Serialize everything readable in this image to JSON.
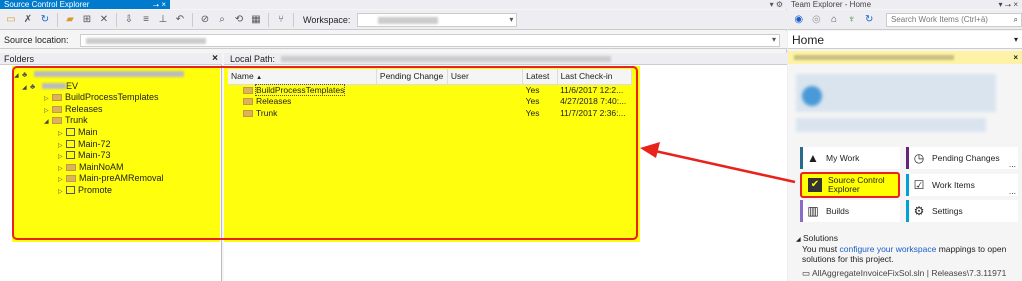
{
  "sce": {
    "tab_title": "Source Control Explorer",
    "tab_pin": "⭢ ×",
    "workspace_label": "Workspace:",
    "source_location_label": "Source location:",
    "folders_label": "Folders",
    "folders_close": "×",
    "local_path_label": "Local Path:",
    "tree": {
      "root_suffix": "EV",
      "items": [
        "BuildProcessTemplates",
        "Releases",
        "Trunk",
        "Main",
        "Main-72",
        "Main-73",
        "MainNoAM",
        "Main-preAMRemoval",
        "Promote"
      ]
    },
    "columns": [
      "Name",
      "Pending Change",
      "User",
      "Latest",
      "Last Check-in"
    ],
    "sort_glyph": "▲",
    "rows": [
      {
        "name": "BuildProcessTemplates",
        "pending": "",
        "user": "",
        "latest": "Yes",
        "checkin": "11/6/2017 12:2..."
      },
      {
        "name": "Releases",
        "pending": "",
        "user": "",
        "latest": "Yes",
        "checkin": "4/27/2018 7:40:..."
      },
      {
        "name": "Trunk",
        "pending": "",
        "user": "",
        "latest": "Yes",
        "checkin": "11/7/2017 2:36:..."
      }
    ]
  },
  "te": {
    "title": "Team Explorer - Home",
    "title_controls": "▾ ⭢ ×",
    "search_placeholder": "Search Work Items (Ctrl+ä)",
    "home_label": "Home",
    "tiles": {
      "my_work": "My Work",
      "pending_changes": "Pending Changes",
      "source_control": "Source Control Explorer",
      "work_items": "Work Items",
      "builds": "Builds",
      "settings": "Settings"
    },
    "ellipsis": "...",
    "solutions": {
      "heading": "Solutions",
      "text_before": "You must ",
      "link": "configure your workspace",
      "text_after": " mappings to open solutions for this project.",
      "file": "AllAggregateInvoiceFixSol.sln | Releases\\7.3.11971"
    }
  },
  "colors": {
    "accent": "#007acc",
    "highlight": "#ffff00",
    "annotation": "#e8231c",
    "tile_builds": "#8a6cc8",
    "tile_pending": "#68217a",
    "tile_workitems": "#00a0d8"
  }
}
